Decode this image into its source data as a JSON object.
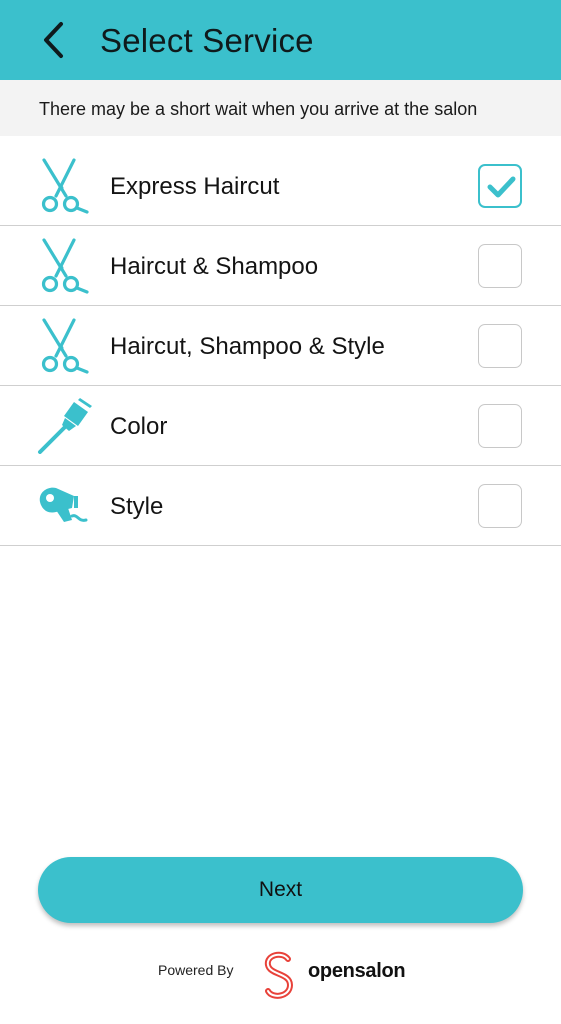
{
  "colors": {
    "accent": "#3bc0cc",
    "brand_red": "#e8423a"
  },
  "header": {
    "title": "Select Service",
    "back_icon": "chevron-left-icon"
  },
  "notice": {
    "text": "There may be a short wait when you arrive at the salon"
  },
  "services": [
    {
      "label": "Express Haircut",
      "icon": "scissors-icon",
      "checked": true
    },
    {
      "label": "Haircut & Shampoo",
      "icon": "scissors-icon",
      "checked": false
    },
    {
      "label": "Haircut, Shampoo & Style",
      "icon": "scissors-icon",
      "checked": false
    },
    {
      "label": "Color",
      "icon": "color-brush-icon",
      "checked": false
    },
    {
      "label": "Style",
      "icon": "hair-dryer-icon",
      "checked": false
    }
  ],
  "next_button": {
    "label": "Next"
  },
  "footer": {
    "powered_by": "Powered By",
    "brand": "opensalon"
  }
}
